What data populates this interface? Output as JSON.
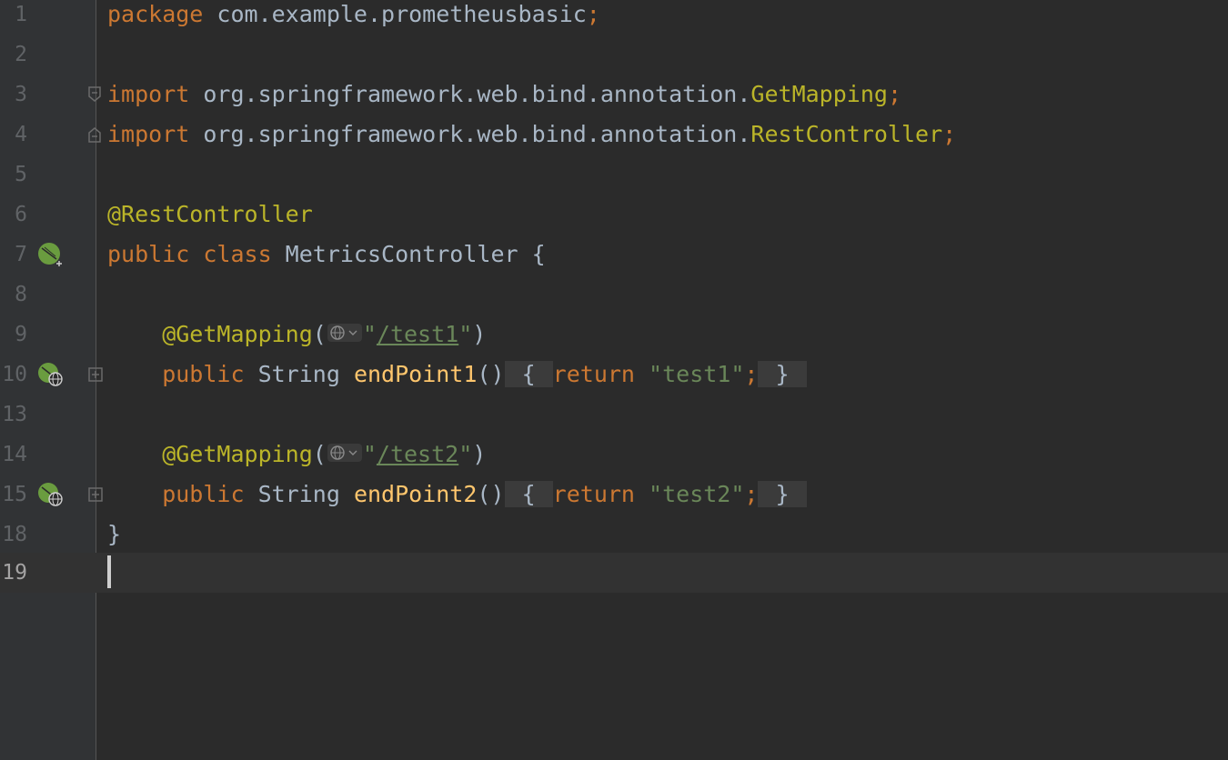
{
  "editor": {
    "lines": [
      {
        "number": "1",
        "parts": [
          "package",
          " com.example.prometheusbasic",
          ";"
        ]
      },
      {
        "number": "2",
        "parts": []
      },
      {
        "number": "3",
        "parts": [
          "import",
          " org.springframework.web.bind.annotation.",
          "GetMapping",
          ";"
        ]
      },
      {
        "number": "4",
        "parts": [
          "import",
          " org.springframework.web.bind.annotation.",
          "RestController",
          ";"
        ]
      },
      {
        "number": "5",
        "parts": []
      },
      {
        "number": "6",
        "parts": [
          "@RestController"
        ]
      },
      {
        "number": "7",
        "parts": [
          "public class",
          " MetricsController {"
        ],
        "gutter_icon": "spring-bean-icon"
      },
      {
        "number": "8",
        "parts": []
      },
      {
        "number": "9",
        "parts": [
          "    @GetMapping",
          "(",
          "\"",
          "/test1",
          "\"",
          ")"
        ],
        "inlay_icon": "globe-dropdown-icon"
      },
      {
        "number": "10",
        "parts": [
          "    public",
          " String ",
          "endPoint1",
          "()",
          " { ",
          "return",
          " \"test1\"",
          ";",
          " } "
        ],
        "gutter_icon": "spring-endpoint-icon"
      },
      {
        "number": "13",
        "parts": []
      },
      {
        "number": "14",
        "parts": [
          "    @GetMapping",
          "(",
          "\"",
          "/test2",
          "\"",
          ")"
        ],
        "inlay_icon": "globe-dropdown-icon"
      },
      {
        "number": "15",
        "parts": [
          "    public",
          " String ",
          "endPoint2",
          "()",
          " { ",
          "return",
          " \"test2\"",
          ";",
          " } "
        ],
        "gutter_icon": "spring-endpoint-icon"
      },
      {
        "number": "18",
        "parts": [
          "}"
        ]
      },
      {
        "number": "19",
        "parts": [],
        "current": true
      }
    ]
  },
  "theme": {
    "background": "#2b2b2b",
    "gutter": "#313335",
    "keyword": "#cc7832",
    "annotation": "#bbb529",
    "method": "#ffc66d",
    "string": "#6a8759",
    "text": "#a9b7c6",
    "spring_green": "#6a9c3f"
  }
}
